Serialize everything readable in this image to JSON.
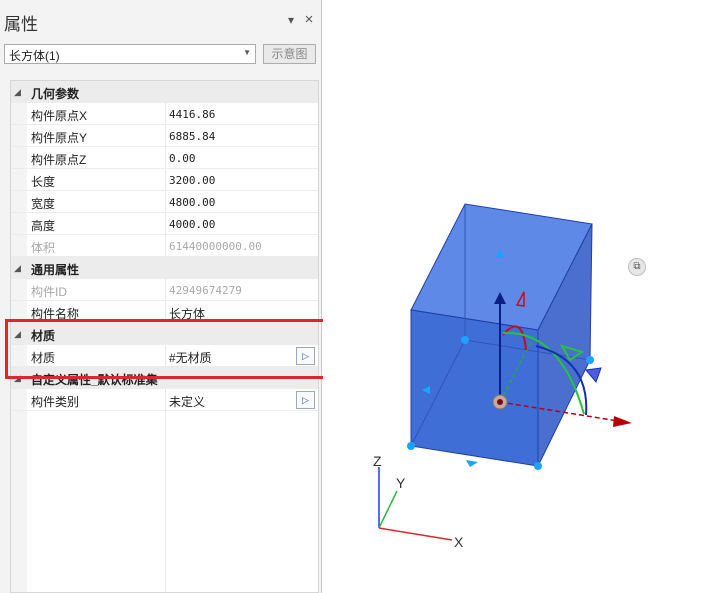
{
  "panel": {
    "title": "属性",
    "pin_icon": "▾",
    "close_icon": "×",
    "object_select": {
      "value": "长方体(1)"
    },
    "preview_button": "示意图"
  },
  "categories": [
    {
      "label": "几何参数",
      "rows": [
        {
          "name": "构件原点X",
          "value": "4416.86"
        },
        {
          "name": "构件原点Y",
          "value": "6885.84"
        },
        {
          "name": "构件原点Z",
          "value": "0.00"
        },
        {
          "name": "长度",
          "value": "3200.00"
        },
        {
          "name": "宽度",
          "value": "4800.00"
        },
        {
          "name": "高度",
          "value": "4000.00"
        },
        {
          "name": "体积",
          "value": "61440000000.00"
        }
      ]
    },
    {
      "label": "通用属性",
      "rows": [
        {
          "name": "构件ID",
          "value": "42949674279"
        },
        {
          "name": "构件名称",
          "value": "长方体"
        }
      ]
    },
    {
      "label": "材质",
      "rows": [
        {
          "name": "材质",
          "value": "#无材质"
        }
      ]
    },
    {
      "label": "自定义属性_默认标准集",
      "rows": [
        {
          "name": "构件类别",
          "value": "未定义"
        }
      ]
    }
  ],
  "viewport": {
    "axis_labels": {
      "x": "X",
      "y": "Y",
      "z": "Z"
    },
    "colors": {
      "box_fill": "#3f6fd6",
      "box_edge": "#1f3fa8",
      "x_axis": "#b8000a",
      "y_axis": "#26a83a",
      "z_axis": "#0b1f86",
      "highlight": "#e0252b"
    }
  }
}
